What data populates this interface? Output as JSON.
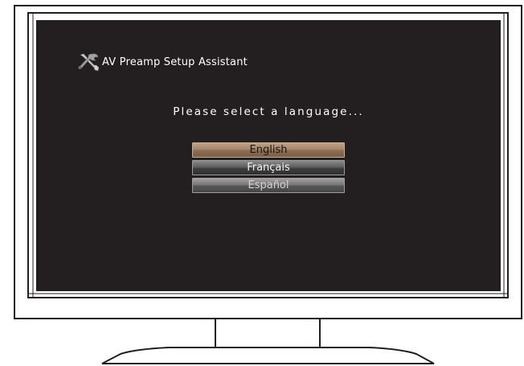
{
  "setup": {
    "title": "AV Preamp Setup Assistant",
    "title_icon": "tools-icon",
    "prompt": "Please select a language...",
    "languages": [
      {
        "label": "English",
        "selected": true
      },
      {
        "label": "Français",
        "selected": false
      },
      {
        "label": "Español",
        "selected": false
      }
    ]
  },
  "colors": {
    "screen_background": "#231f20",
    "text": "#ffffff",
    "selected_highlight": "#a58466",
    "option_background": "#5e5e5e",
    "monitor_outline": "#231f20"
  }
}
